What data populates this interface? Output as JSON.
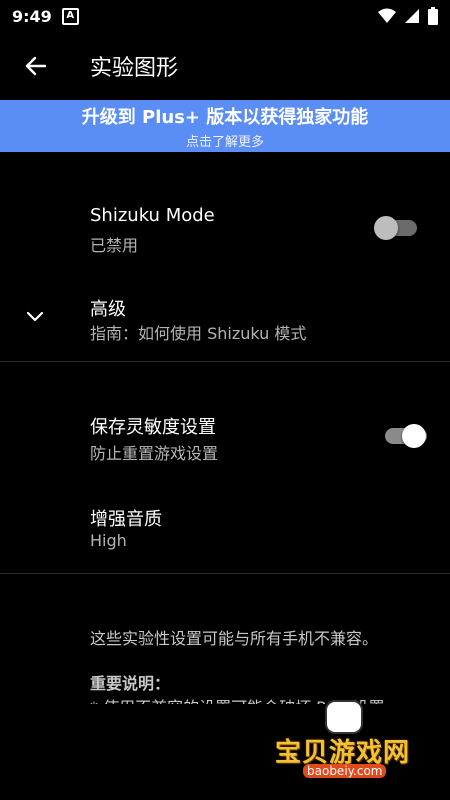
{
  "status_bar": {
    "time": "9:49",
    "notification_letter": "A"
  },
  "app_bar": {
    "title": "实验图形"
  },
  "banner": {
    "title": "升级到 Plus+ 版本以获得独家功能",
    "subtitle": "点击了解更多"
  },
  "settings": {
    "shizuku_mode": {
      "title": "Shizuku Mode",
      "summary": "已禁用",
      "enabled": false
    },
    "advanced": {
      "title": "高级",
      "summary": "指南：如何使用 Shizuku 模式"
    },
    "save_sensitivity": {
      "title": "保存灵敏度设置",
      "summary": "防止重置游戏设置",
      "enabled": true
    },
    "audio_quality": {
      "title": "增强音质",
      "summary": "High"
    }
  },
  "notes": {
    "warning": "这些实验性设置可能与所有手机不兼容。",
    "important_title": "重要说明：",
    "important_item": "* 使用不兼容的设置可能会破坏 PGT 设置"
  },
  "watermark": {
    "text": "宝贝游戏网",
    "url": "baobeiy.com"
  },
  "colors": {
    "banner": "#5b8ef5",
    "toggle_off_track": "#6b6b6b",
    "toggle_off_thumb": "#bdbdbd",
    "toggle_on_track": "#8a8a8a",
    "toggle_on_thumb": "#ffffff"
  }
}
